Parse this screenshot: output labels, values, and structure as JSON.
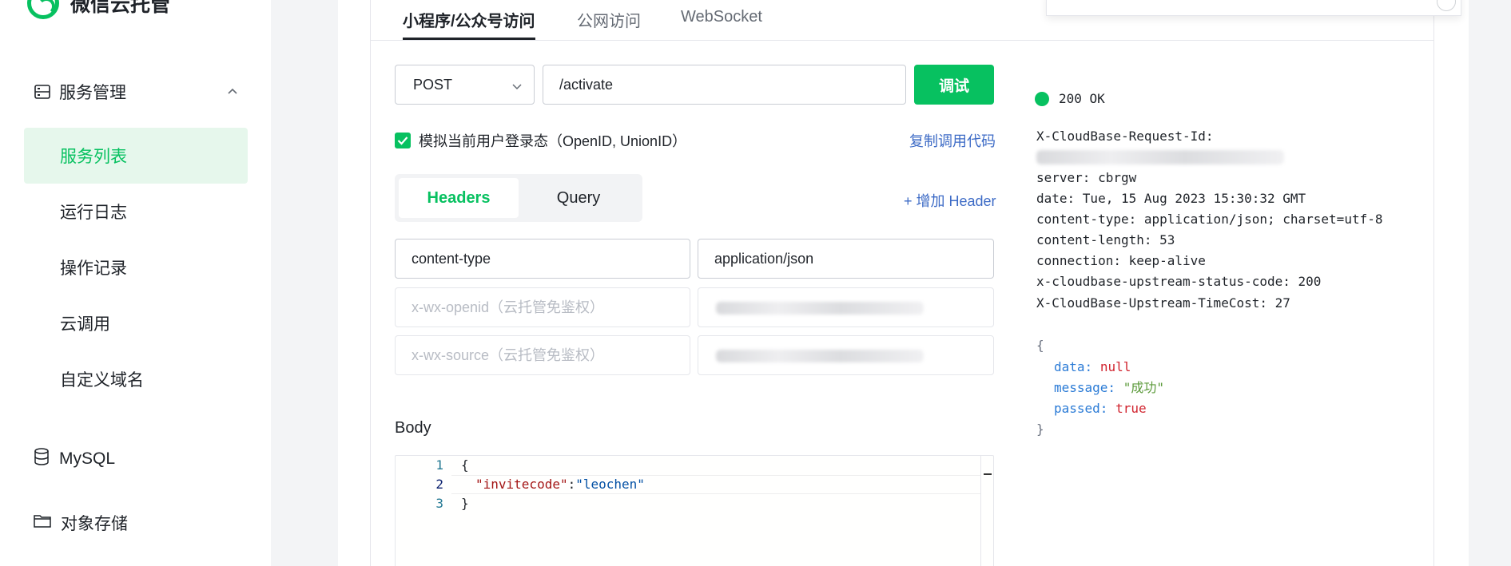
{
  "sidebar": {
    "logo_text": "微信云托管",
    "group_label": "服务管理",
    "items": [
      {
        "label": "服务列表",
        "active": true
      },
      {
        "label": "运行日志"
      },
      {
        "label": "操作记录"
      },
      {
        "label": "云调用"
      },
      {
        "label": "自定义域名"
      }
    ],
    "bottom": [
      {
        "label": "MySQL",
        "icon": "database-icon"
      },
      {
        "label": "对象存储",
        "icon": "folder-icon"
      }
    ]
  },
  "tabs": [
    {
      "label": "小程序/公众号访问",
      "active": true
    },
    {
      "label": "公网访问"
    },
    {
      "label": "WebSocket"
    }
  ],
  "request": {
    "method": "POST",
    "path": "/activate",
    "test_label": "调试",
    "simulate_label": "模拟当前用户登录态（OpenID, UnionID）",
    "copy_code_label": "复制调用代码",
    "segments": [
      "Headers",
      "Query"
    ],
    "add_header_label": "+ 增加 Header",
    "headers": [
      {
        "key": "content-type",
        "value": "application/json"
      },
      {
        "key_placeholder": "x-wx-openid（云托管免鉴权）"
      },
      {
        "key_placeholder": "x-wx-source（云托管免鉴权）"
      }
    ],
    "body_label": "Body",
    "body_lines": [
      "1",
      "2",
      "3"
    ],
    "body_code": {
      "open": "{",
      "key": "\"invitecode\"",
      "colon": ":",
      "value": "\"leochen\"",
      "close": "}"
    }
  },
  "response": {
    "status": "200 OK",
    "request_id_label": "X-CloudBase-Request-Id:",
    "headers": [
      "server: cbrgw",
      "date: Tue, 15 Aug 2023 15:30:32 GMT",
      "content-type: application/json; charset=utf-8",
      "content-length: 53",
      "connection: keep-alive",
      "x-cloudbase-upstream-status-code: 200",
      "X-CloudBase-Upstream-TimeCost: 27"
    ],
    "json": {
      "open": "{",
      "data_key": "data:",
      "data_val": "null",
      "message_key": "message:",
      "message_val": "\"成功\"",
      "passed_key": "passed:",
      "passed_val": "true",
      "close": "}"
    }
  },
  "colors": {
    "accent": "#07c160",
    "link": "#3d6bc6"
  }
}
